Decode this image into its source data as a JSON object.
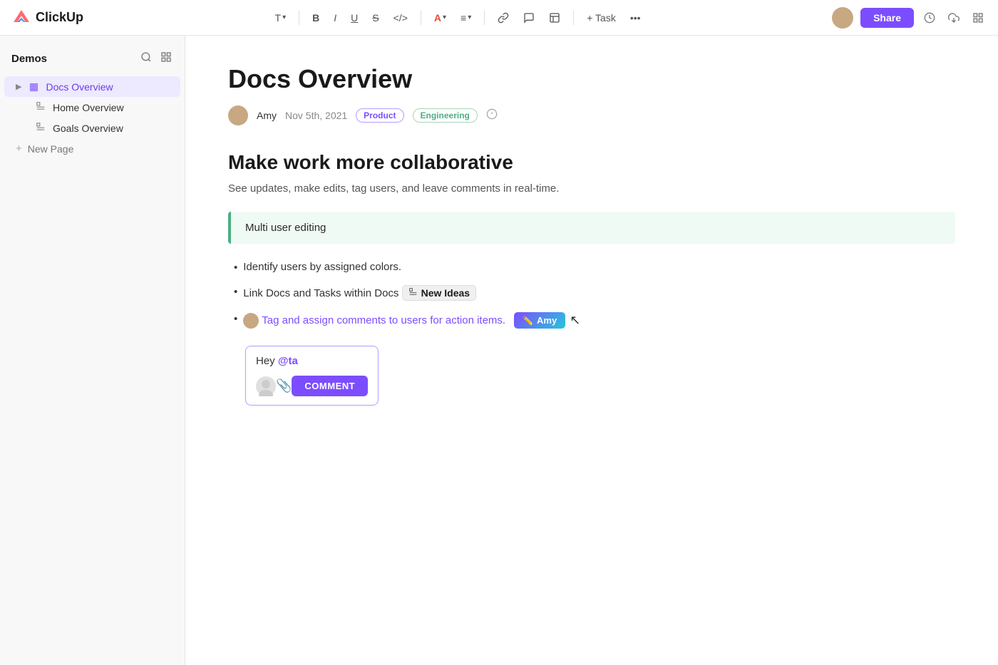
{
  "app": {
    "name": "ClickUp"
  },
  "toolbar": {
    "text_label": "T",
    "bold_label": "B",
    "italic_label": "I",
    "underline_label": "U",
    "strikethrough_label": "S",
    "code_label": "</>",
    "color_label": "A",
    "align_label": "≡",
    "link_label": "🔗",
    "comment_label": "💬",
    "attach_label": "📎",
    "task_label": "+ Task",
    "more_label": "•••",
    "share_label": "Share"
  },
  "sidebar": {
    "workspace_label": "Demos",
    "items": [
      {
        "id": "docs-overview",
        "label": "Docs Overview",
        "icon": "▦",
        "active": true
      },
      {
        "id": "home-overview",
        "label": "Home Overview",
        "icon": "☰",
        "active": false
      },
      {
        "id": "goals-overview",
        "label": "Goals Overview",
        "icon": "☰",
        "active": false
      }
    ],
    "new_page_label": "New Page"
  },
  "doc": {
    "title": "Docs Overview",
    "author": "Amy",
    "date": "Nov 5th, 2021",
    "tags": [
      {
        "label": "Product",
        "type": "product"
      },
      {
        "label": "Engineering",
        "type": "engineering"
      }
    ],
    "heading": "Make work more collaborative",
    "subtitle": "See updates, make edits, tag users, and leave comments in real-time.",
    "callout": "Multi user editing",
    "bullets": [
      {
        "text": "Identify users by assigned colors."
      },
      {
        "text_before": "Link Docs and Tasks within Docs",
        "link_label": "New Ideas",
        "has_link": true
      },
      {
        "text_highlighted": "Tag and assign comments to users for action items.",
        "has_highlight": true
      }
    ],
    "amy_tooltip": "Amy",
    "comment": {
      "input_text": "Hey ",
      "mention": "@ta",
      "attach_icon": "📎",
      "button_label": "COMMENT"
    }
  }
}
